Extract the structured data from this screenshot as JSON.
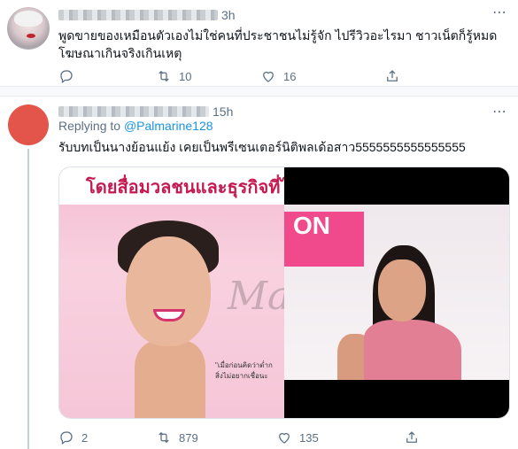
{
  "tweet1": {
    "time": "3h",
    "text_line1": "พูดขายของเหมือนตัวเองไม่ใช่คนที่ประชาชนไม่รู้จัก ไปรีวิวอะไรมา ชาวเน็ตก็รู้หมด",
    "text_line2": "โฆษณาเกินจริงเกินเหตุ",
    "retweets": "10",
    "likes": "16"
  },
  "tweet2": {
    "time": "15h",
    "replying_prefix": "Replying to",
    "replying_handle": "@Palmarine128",
    "text": "รับบทเป็นนางย้อนแย้ง เคยเป็นพรีเซนเตอร์นิติพลเด้อสาว5555555555555555",
    "replies": "2",
    "retweets": "879",
    "likes": "135",
    "media_left_banner": "โดยสื่อมวลชนและธุรกิจที่ไร",
    "media_left_script": "Ma",
    "media_left_note_line1": "\"เมื่อก่อนคิดว่าต่ำก",
    "media_left_note_line2": "สิ่งไม่อยากเชื่อนะ",
    "media_right_sign": "ON"
  },
  "icons": {
    "more": "more-dots-icon",
    "reply": "reply-icon",
    "retweet": "retweet-icon",
    "like": "heart-icon",
    "share": "share-icon"
  },
  "colors": {
    "link": "#1b95e0",
    "muted": "#5b7083",
    "avatar2": "#e3554a"
  }
}
